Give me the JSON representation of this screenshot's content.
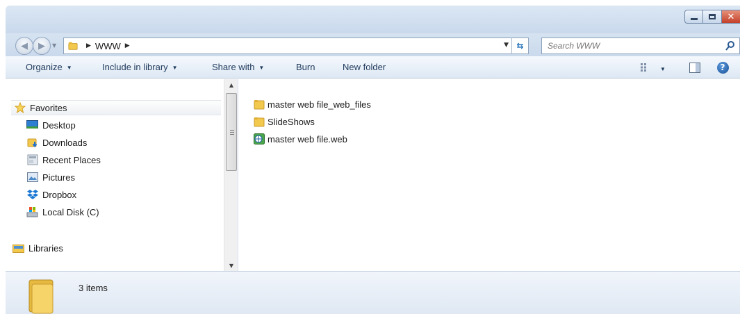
{
  "window": {
    "caption_buttons": [
      "minimize-icon",
      "maximize-icon",
      "close-icon"
    ]
  },
  "addressbar": {
    "breadcrumb": [
      "WWW"
    ],
    "search_placeholder": "Search WWW"
  },
  "toolbar": {
    "organize_label": "Organize",
    "include_label": "Include in library",
    "share_label": "Share with",
    "burn_label": "Burn",
    "newfolder_label": "New folder",
    "icons": [
      "view-options-icon",
      "preview-pane-icon",
      "help-icon"
    ]
  },
  "navpane": {
    "favorites": {
      "label": "Favorites",
      "items": [
        {
          "label": "Desktop",
          "icon": "desktop-icon"
        },
        {
          "label": "Downloads",
          "icon": "downloads-icon"
        },
        {
          "label": "Recent Places",
          "icon": "recent-places-icon"
        },
        {
          "label": "Pictures",
          "icon": "pictures-icon"
        },
        {
          "label": "Dropbox",
          "icon": "dropbox-icon"
        },
        {
          "label": "Local Disk (C)",
          "icon": "local-disk-icon"
        }
      ]
    },
    "libraries_label": "Libraries"
  },
  "files": [
    {
      "name": "master web file_web_files",
      "icon": "folder-icon"
    },
    {
      "name": "SlideShows",
      "icon": "folder-icon"
    },
    {
      "name": "master web file.web",
      "icon": "web-file-icon"
    }
  ],
  "details": {
    "count_text": "3 items"
  },
  "colors": {
    "accent": "#1e395b",
    "folder": "#f2c94c",
    "close_button": "#c4402a"
  }
}
